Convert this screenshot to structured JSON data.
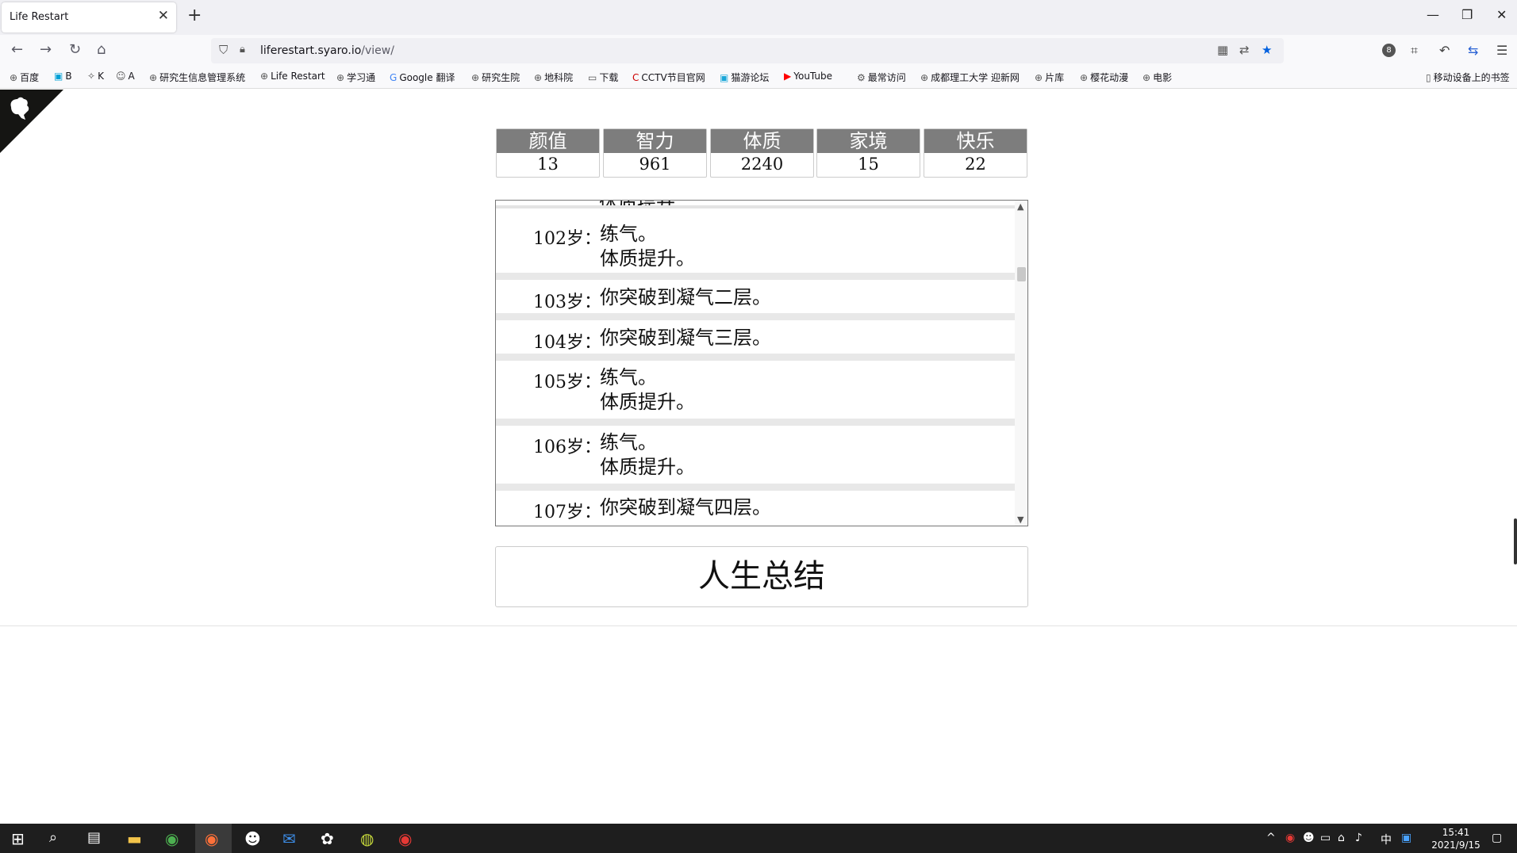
{
  "browser": {
    "tab_title": "Life Restart",
    "tab_close": "✕",
    "new_tab": "+",
    "url_host": "liferestart.syaro.io",
    "url_path": "/view/",
    "window_controls": {
      "minimize": "—",
      "restore": "❐",
      "close": "✕"
    },
    "toolbar_badge": "8"
  },
  "bookmarks": [
    {
      "label": "百度",
      "icon": "globe-icon"
    },
    {
      "label": "B",
      "icon": "bilibili-icon"
    },
    {
      "label": "K",
      "icon": "site-icon"
    },
    {
      "label": "A",
      "icon": "avatar-icon"
    },
    {
      "label": "研究生信息管理系统",
      "icon": "globe-icon"
    },
    {
      "label": "Life Restart",
      "icon": "globe-icon"
    },
    {
      "label": "学习通",
      "icon": "globe-icon"
    },
    {
      "label": "Google 翻译",
      "icon": "translate-icon"
    },
    {
      "label": "研究生院",
      "icon": "globe-icon"
    },
    {
      "label": "地科院",
      "icon": "globe-icon"
    },
    {
      "label": "下载",
      "icon": "folder-icon"
    },
    {
      "label": "CCTV节目官网",
      "icon": "cctv-icon"
    },
    {
      "label": "猫游论坛",
      "icon": "forum-icon"
    },
    {
      "label": "YouTube",
      "icon": "youtube-icon"
    },
    {
      "label": "最常访问",
      "icon": "gear-icon"
    },
    {
      "label": "成都理工大学 迎新网",
      "icon": "globe-icon"
    },
    {
      "label": "片库",
      "icon": "globe-icon"
    },
    {
      "label": "樱花动漫",
      "icon": "globe-icon"
    },
    {
      "label": "电影",
      "icon": "globe-icon"
    }
  ],
  "mobile_bookmarks": "移动设备上的书签",
  "properties": [
    {
      "label": "颜值",
      "value": "13"
    },
    {
      "label": "智力",
      "value": "961"
    },
    {
      "label": "体质",
      "value": "2240"
    },
    {
      "label": "家境",
      "value": "15"
    },
    {
      "label": "快乐",
      "value": "22"
    }
  ],
  "trajectory": {
    "partial_top_text": "体质提升。",
    "rows": [
      {
        "age": "102岁：",
        "lines": [
          "练气。",
          "体质提升。"
        ]
      },
      {
        "age": "103岁：",
        "lines": [
          "你突破到凝气二层。"
        ]
      },
      {
        "age": "104岁：",
        "lines": [
          "你突破到凝气三层。"
        ]
      },
      {
        "age": "105岁：",
        "lines": [
          "练气。",
          "体质提升。"
        ]
      },
      {
        "age": "106岁：",
        "lines": [
          "练气。",
          "体质提升。"
        ]
      },
      {
        "age": "107岁：",
        "lines": [
          "你突破到凝气四层。"
        ]
      }
    ],
    "scroll_position": 0.2
  },
  "summary_button": "人生总结",
  "taskbar": {
    "time": "15:41",
    "date": "2021/9/15",
    "ime": "中"
  }
}
